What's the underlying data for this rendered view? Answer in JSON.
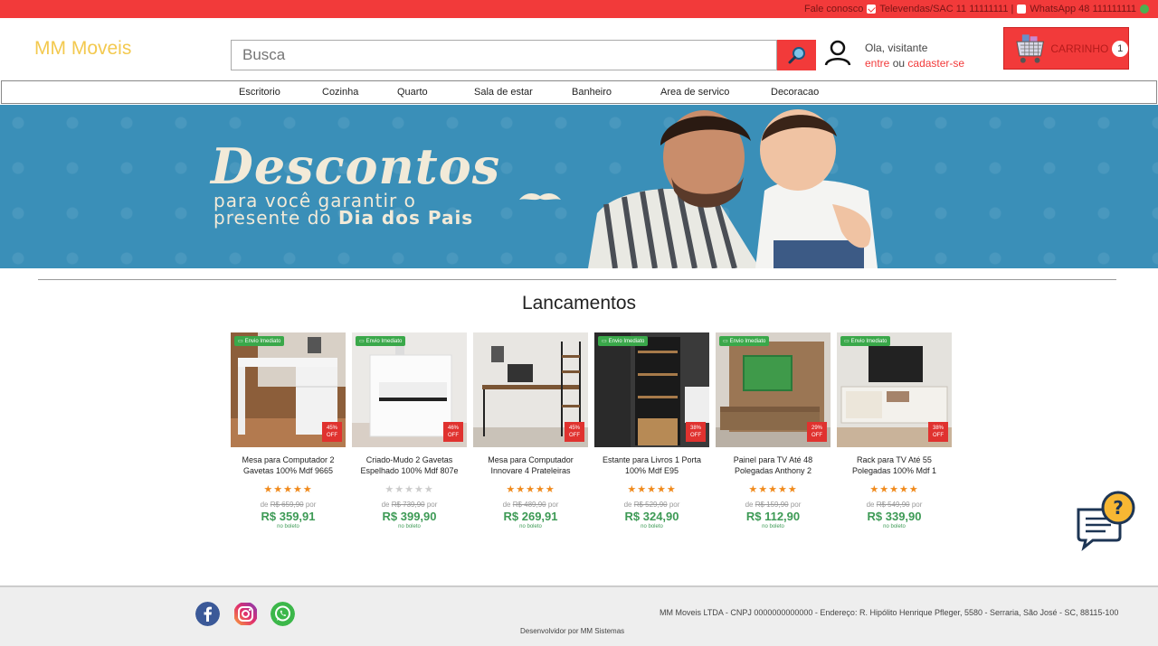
{
  "topbar": {
    "contact": "Fale conosco",
    "phone": "Televendas/SAC 11 11111111 |",
    "whatsapp": "WhatsApp 48 111111111"
  },
  "header": {
    "logo": "MM Moveis",
    "search_placeholder": "Busca",
    "greeting": "Ola, visitante",
    "login_link": "entre",
    "or_text": "ou",
    "signup_link": "cadaster-se",
    "cart_label": "CARRINHO",
    "cart_count": "1"
  },
  "nav": {
    "items": [
      "Escritorio",
      "Cozinha",
      "Quarto",
      "Sala de estar",
      "Banheiro",
      "Area de servico",
      "Decoracao"
    ]
  },
  "banner": {
    "title": "Descontos",
    "line1": "para você garantir o",
    "line2_prefix": "presente do ",
    "line2_bold": "Dia dos Pais"
  },
  "section": {
    "title": "Lancamentos"
  },
  "products": [
    {
      "tag": "Envio Imediato",
      "discount": "45%",
      "off": "OFF",
      "name": "Mesa para Computador 2 Gavetas 100% Mdf 9665",
      "rating": 5,
      "old_price": "R$ 659,90",
      "price": "R$ 359,91",
      "de": "de",
      "por": "por",
      "boleto": "no boleto"
    },
    {
      "tag": "Envio Imediato",
      "discount": "46%",
      "off": "OFF",
      "name": "Criado-Mudo 2 Gavetas Espelhado 100% Mdf 807e",
      "rating": 0,
      "old_price": "R$ 739,90",
      "price": "R$ 399,90",
      "de": "de",
      "por": "por",
      "boleto": "no boleto"
    },
    {
      "tag": "",
      "discount": "45%",
      "off": "OFF",
      "name": "Mesa para Computador Innovare 4 Prateleiras",
      "rating": 5,
      "old_price": "R$ 489,90",
      "price": "R$ 269,91",
      "de": "de",
      "por": "por",
      "boleto": "no boleto"
    },
    {
      "tag": "Envio Imediato",
      "discount": "38%",
      "off": "OFF",
      "name": "Estante para Livros 1 Porta 100% Mdf E95",
      "rating": 4.5,
      "old_price": "R$ 529,90",
      "price": "R$ 324,90",
      "de": "de",
      "por": "por",
      "boleto": "no boleto"
    },
    {
      "tag": "Envio Imediato",
      "discount": "29%",
      "off": "OFF",
      "name": "Painel para TV Até 48 Polegadas Anthony 2",
      "rating": 4.5,
      "old_price": "R$ 159,90",
      "price": "R$ 112,90",
      "de": "de",
      "por": "por",
      "boleto": "no boleto"
    },
    {
      "tag": "Envio Imediato",
      "discount": "38%",
      "off": "OFF",
      "name": "Rack para TV Até 55 Polegadas 100% Mdf 1",
      "rating": 5,
      "old_price": "R$ 549,90",
      "price": "R$ 339,90",
      "de": "de",
      "por": "por",
      "boleto": "no boleto"
    }
  ],
  "footer": {
    "info": "MM Moveis LTDA - CNPJ 0000000000000 - Endereço: R. Hipólito Henrique Pfleger, 5580 - Serraria, São José - SC, 88115-100",
    "dev": "Desenvolvidor por MM Sistemas"
  },
  "colors": {
    "accent": "#f23a3a",
    "logo": "#f3c94f",
    "price": "#3d9a55",
    "banner": "#3a8fb8"
  }
}
